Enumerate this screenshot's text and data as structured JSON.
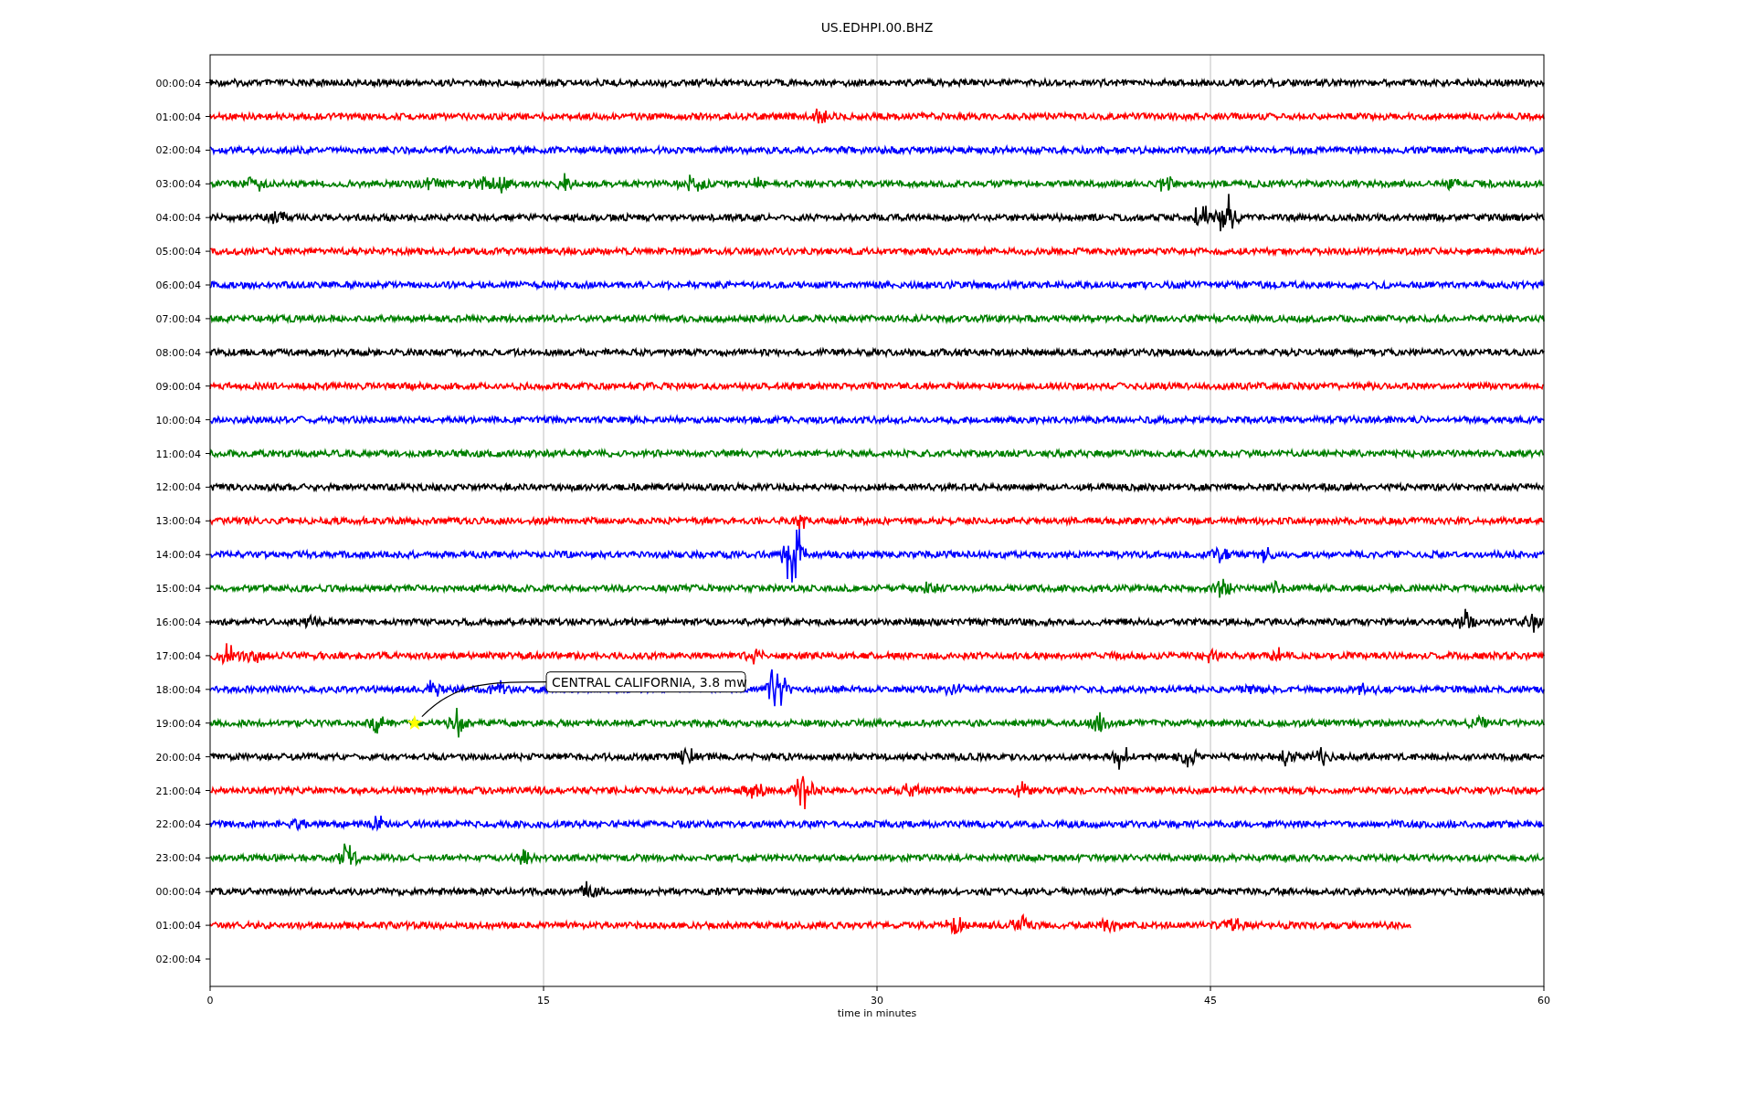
{
  "title": "US.EDHPI.00.BHZ",
  "plot": {
    "xlabel": "time in minutes",
    "xticks": [
      "0",
      "15",
      "30",
      "45",
      "60"
    ],
    "rows": [
      {
        "label": "00:00:04",
        "color": "#000000",
        "kind": "full"
      },
      {
        "label": "01:00:04",
        "color": "#ff0000",
        "kind": "full"
      },
      {
        "label": "02:00:04",
        "color": "#0000ff",
        "kind": "full"
      },
      {
        "label": "03:00:04",
        "color": "#008000",
        "kind": "full"
      },
      {
        "label": "04:00:04",
        "color": "#000000",
        "kind": "full"
      },
      {
        "label": "05:00:04",
        "color": "#ff0000",
        "kind": "full"
      },
      {
        "label": "06:00:04",
        "color": "#0000ff",
        "kind": "full"
      },
      {
        "label": "07:00:04",
        "color": "#008000",
        "kind": "full"
      },
      {
        "label": "08:00:04",
        "color": "#000000",
        "kind": "full"
      },
      {
        "label": "09:00:04",
        "color": "#ff0000",
        "kind": "full"
      },
      {
        "label": "10:00:04",
        "color": "#0000ff",
        "kind": "full"
      },
      {
        "label": "11:00:04",
        "color": "#008000",
        "kind": "full"
      },
      {
        "label": "12:00:04",
        "color": "#000000",
        "kind": "full"
      },
      {
        "label": "13:00:04",
        "color": "#ff0000",
        "kind": "full"
      },
      {
        "label": "14:00:04",
        "color": "#0000ff",
        "kind": "full"
      },
      {
        "label": "15:00:04",
        "color": "#008000",
        "kind": "full"
      },
      {
        "label": "16:00:04",
        "color": "#000000",
        "kind": "full"
      },
      {
        "label": "17:00:04",
        "color": "#ff0000",
        "kind": "full"
      },
      {
        "label": "18:00:04",
        "color": "#0000ff",
        "kind": "full"
      },
      {
        "label": "19:00:04",
        "color": "#008000",
        "kind": "full"
      },
      {
        "label": "20:00:04",
        "color": "#000000",
        "kind": "full"
      },
      {
        "label": "21:00:04",
        "color": "#ff0000",
        "kind": "full"
      },
      {
        "label": "22:00:04",
        "color": "#0000ff",
        "kind": "full"
      },
      {
        "label": "23:00:04",
        "color": "#008000",
        "kind": "full"
      },
      {
        "label": "00:00:04",
        "color": "#000000",
        "kind": "full"
      },
      {
        "label": "01:00:04",
        "color": "#ff0000",
        "kind": "partial"
      },
      {
        "label": "02:00:04",
        "kind": "none"
      }
    ],
    "annotation": {
      "text": "CENTRAL CALIFORNIA, 3.8 mw"
    }
  }
}
